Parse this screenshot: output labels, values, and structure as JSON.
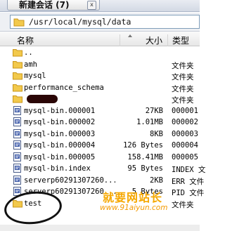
{
  "tab": {
    "title": "新建会话 (7)",
    "close_label": "x"
  },
  "path": {
    "value": "/usr/local/mysql/data"
  },
  "columns": {
    "name": "名称",
    "size": "大小",
    "type": "类型"
  },
  "rows": [
    {
      "name": "..",
      "size": "",
      "type": "",
      "icon": "folder-icon"
    },
    {
      "name": "amh",
      "size": "",
      "type": "文件夹",
      "icon": "folder-icon"
    },
    {
      "name": "mysql",
      "size": "",
      "type": "文件夹",
      "icon": "folder-icon"
    },
    {
      "name": "performance_schema",
      "size": "",
      "type": "文件夹",
      "icon": "folder-icon"
    },
    {
      "name": "",
      "size": "",
      "type": "文件夹",
      "icon": "folder-icon"
    },
    {
      "name": "mysql-bin.000001",
      "size": "27KB",
      "type": "000001",
      "icon": "file-icon"
    },
    {
      "name": "mysql-bin.000002",
      "size": "1.01MB",
      "type": "000002",
      "icon": "file-icon"
    },
    {
      "name": "mysql-bin.000003",
      "size": "8KB",
      "type": "000003",
      "icon": "file-icon"
    },
    {
      "name": "mysql-bin.000004",
      "size": "126 Bytes",
      "type": "000004",
      "icon": "file-icon"
    },
    {
      "name": "mysql-bin.000005",
      "size": "158.41MB",
      "type": "000005",
      "icon": "file-icon"
    },
    {
      "name": "mysql-bin.index",
      "size": "95 Bytes",
      "type": "INDEX 文",
      "icon": "file-icon"
    },
    {
      "name": "serverp60291307260...",
      "size": "2KB",
      "type": "ERR 文件",
      "icon": "file-icon"
    },
    {
      "name": "serverp60291307260...",
      "size": "5 Bytes",
      "type": "PID 文件",
      "icon": "file-icon"
    },
    {
      "name": "test",
      "size": "",
      "type": "文件夹",
      "icon": "folder-icon"
    }
  ],
  "watermark": {
    "cn": "就要网站长",
    "url": "www.91aiyun.com"
  },
  "colors": {
    "folder": "#f2c94c",
    "folder_edge": "#c9961a",
    "path_border": "#7f9db9"
  }
}
